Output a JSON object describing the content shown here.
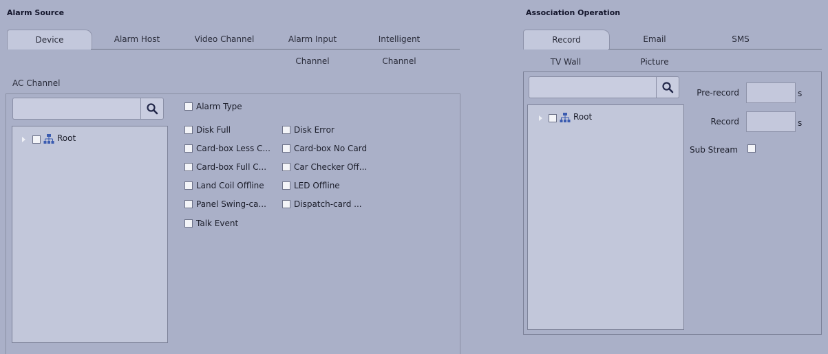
{
  "alarm_source": {
    "title": "Alarm Source",
    "tabs": [
      {
        "label": "Device"
      },
      {
        "label": "Alarm Host"
      },
      {
        "label": "Video Channel"
      },
      {
        "label": "Alarm Input",
        "label2": "Channel"
      },
      {
        "label": "Intelligent",
        "label2": "Channel"
      }
    ],
    "section_label": "AC Channel",
    "search": {
      "value": "",
      "placeholder": ""
    },
    "tree_root": "Root",
    "alarm_type_label": "Alarm Type",
    "alarm_types": [
      "Disk Full",
      "Disk Error",
      "Card-box Less C...",
      "Card-box No Card",
      "Card-box Full C...",
      "Car Checker Off...",
      "Land Coil Offline",
      "LED Offline",
      "Panel Swing-ca...",
      "Dispatch-card ...",
      "Talk Event"
    ]
  },
  "association": {
    "title": "Association Operation",
    "tabs": [
      {
        "label": "Record"
      },
      {
        "label": "Email"
      },
      {
        "label": "SMS"
      },
      {
        "label": "TV Wall"
      },
      {
        "label": "Picture"
      }
    ],
    "search": {
      "value": "",
      "placeholder": ""
    },
    "tree_root": "Root",
    "pre_record": {
      "label": "Pre-record",
      "value": "",
      "unit": "s"
    },
    "record": {
      "label": "Record",
      "value": "",
      "unit": "s"
    },
    "sub_stream_label": "Sub Stream"
  },
  "colors": {
    "background": "#aab0c8",
    "active_tab": "#c3c8dc",
    "panel": "#c2c7da"
  }
}
